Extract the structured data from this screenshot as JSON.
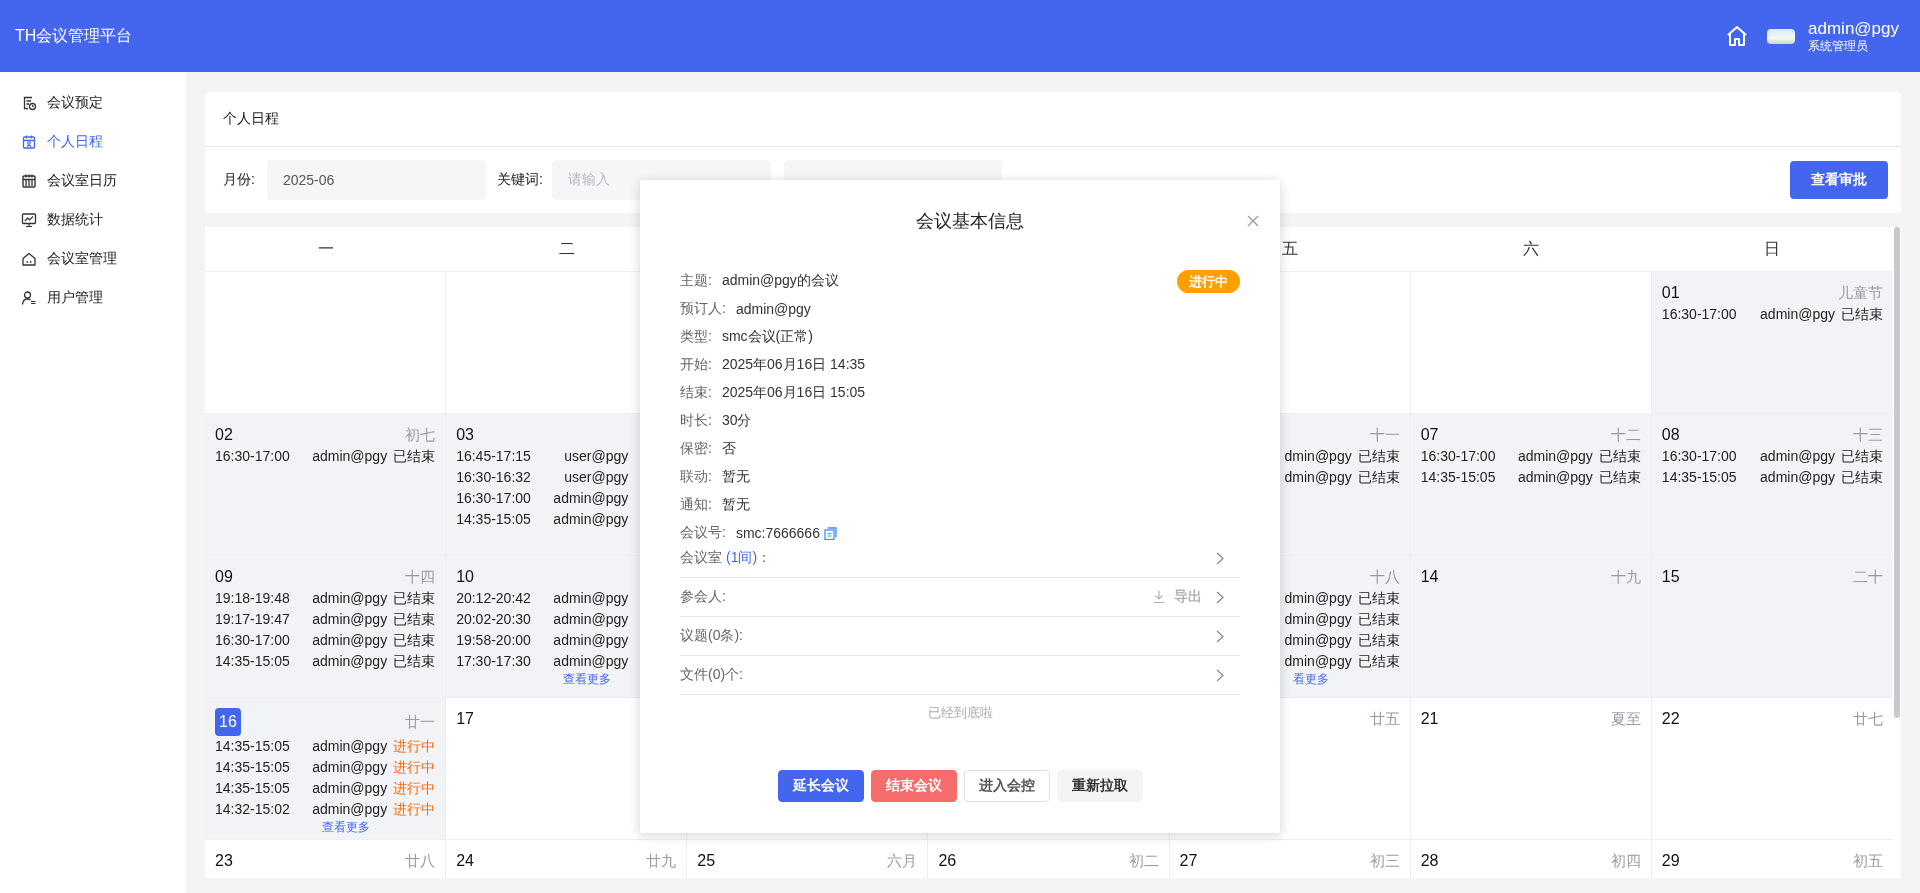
{
  "header": {
    "logo": "TH会议管理平台",
    "user": {
      "name": "admin@pgy",
      "role": "系统管理员"
    }
  },
  "sidebar": {
    "items": [
      {
        "label": "会议预定",
        "selected": false
      },
      {
        "label": "个人日程",
        "selected": true
      },
      {
        "label": "会议室日历",
        "selected": false
      },
      {
        "label": "数据统计",
        "selected": false
      },
      {
        "label": "会议室管理",
        "selected": false
      },
      {
        "label": "用户管理",
        "selected": false
      }
    ]
  },
  "page": {
    "title": "个人日程"
  },
  "filters": {
    "month": {
      "label": "月份:",
      "value": "2025-06"
    },
    "keyword": {
      "label": "关键词:",
      "placeholder": "请输入"
    },
    "approval_button": "查看审批"
  },
  "calendar": {
    "weekdays": {
      "mon": "一",
      "tue": "二",
      "fri": "五",
      "sat": "六",
      "sun": "日"
    },
    "weeks": [
      {
        "sun": {
          "date": "01",
          "lunar": "儿童节",
          "past": true,
          "today": false,
          "events": [
            {
              "time": "16:30-17:00",
              "user": "admin@pgy",
              "status": "已结束",
              "color": "#222222"
            }
          ]
        }
      },
      {
        "mon": {
          "date": "02",
          "lunar": "初七",
          "past": true,
          "today": false,
          "events": [
            {
              "time": "16:30-17:00",
              "user": "admin@pgy",
              "status": "已结束",
              "color": "#222222"
            }
          ]
        },
        "tue": {
          "date": "03",
          "past": true,
          "today": false,
          "events": [
            {
              "time": "16:45-17:15",
              "user": "user@pgy"
            },
            {
              "time": "16:30-16:32",
              "user": "user@pgy"
            },
            {
              "time": "16:30-17:00",
              "user": "admin@pgy"
            },
            {
              "time": "14:35-15:05",
              "user": "admin@pgy"
            }
          ]
        },
        "fri": {
          "lunar": "十一",
          "past": true,
          "events": [
            {
              "user": "dmin@pgy",
              "status": "已结束",
              "color": "#222222"
            },
            {
              "user": "dmin@pgy",
              "status": "已结束",
              "color": "#222222"
            }
          ]
        },
        "sat": {
          "date": "07",
          "lunar": "十二",
          "past": true,
          "today": false,
          "events": [
            {
              "time": "16:30-17:00",
              "user": "admin@pgy",
              "status": "已结束",
              "color": "#222222"
            },
            {
              "time": "14:35-15:05",
              "user": "admin@pgy",
              "status": "已结束",
              "color": "#222222"
            }
          ]
        },
        "sun": {
          "date": "08",
          "lunar": "十三",
          "past": true,
          "today": false,
          "events": [
            {
              "time": "16:30-17:00",
              "user": "admin@pgy",
              "status": "已结束",
              "color": "#222222"
            },
            {
              "time": "14:35-15:05",
              "user": "admin@pgy",
              "status": "已结束",
              "color": "#222222"
            }
          ]
        }
      },
      {
        "mon": {
          "date": "09",
          "lunar": "十四",
          "past": true,
          "today": false,
          "events": [
            {
              "time": "19:18-19:48",
              "user": "admin@pgy",
              "status": "已结束",
              "color": "#222222"
            },
            {
              "time": "19:17-19:47",
              "user": "admin@pgy",
              "status": "已结束",
              "color": "#222222"
            },
            {
              "time": "16:30-17:00",
              "user": "admin@pgy",
              "status": "已结束",
              "color": "#222222"
            },
            {
              "time": "14:35-15:05",
              "user": "admin@pgy",
              "status": "已结束",
              "color": "#222222"
            }
          ]
        },
        "tue": {
          "date": "10",
          "past": true,
          "today": false,
          "events": [
            {
              "time": "20:12-20:42",
              "user": "admin@pgy"
            },
            {
              "time": "20:02-20:30",
              "user": "admin@pgy"
            },
            {
              "time": "19:58-20:00",
              "user": "admin@pgy"
            },
            {
              "time": "17:30-17:30",
              "user": "admin@pgy"
            }
          ],
          "more": "查看更多"
        },
        "fri": {
          "lunar": "十八",
          "past": true,
          "events": [
            {
              "user": "dmin@pgy",
              "status": "已结束",
              "color": "#222222"
            },
            {
              "user": "dmin@pgy",
              "status": "已结束",
              "color": "#222222"
            },
            {
              "user": "dmin@pgy",
              "status": "已结束",
              "color": "#222222"
            },
            {
              "user": "dmin@pgy",
              "status": "已结束",
              "color": "#222222"
            }
          ],
          "more": "看更多"
        },
        "sat": {
          "date": "14",
          "lunar": "十九",
          "past": true,
          "today": false
        },
        "sun": {
          "date": "15",
          "lunar": "二十",
          "past": true,
          "today": false
        }
      },
      {
        "mon": {
          "date": "16",
          "lunar": "廿一",
          "past": true,
          "today": true,
          "events": [
            {
              "time": "14:35-15:05",
              "user": "admin@pgy",
              "status": "进行中",
              "color": "#ff6a00"
            },
            {
              "time": "14:35-15:05",
              "user": "admin@pgy",
              "status": "进行中",
              "color": "#ff6a00"
            },
            {
              "time": "14:35-15:05",
              "user": "admin@pgy",
              "status": "进行中",
              "color": "#ff6a00"
            },
            {
              "time": "14:32-15:02",
              "user": "admin@pgy",
              "status": "进行中",
              "color": "#ff6a00"
            }
          ],
          "more": "查看更多"
        },
        "tue": {
          "date": "17",
          "past": false,
          "today": false
        },
        "fri": {
          "lunar": "廿五",
          "past": false
        },
        "sat": {
          "date": "21",
          "lunar": "夏至",
          "past": false,
          "today": false
        },
        "sun": {
          "date": "22",
          "lunar": "廿七",
          "past": false,
          "today": false
        }
      },
      {
        "mon": {
          "date": "23",
          "lunar": "廿八",
          "past": false,
          "today": false
        },
        "tue": {
          "date": "24",
          "lunar": "廿九",
          "past": false,
          "today": false
        },
        "wed": {
          "date": "25",
          "lunar": "六月",
          "past": false,
          "today": false
        },
        "thu": {
          "date": "26",
          "lunar": "初二",
          "past": false,
          "today": false
        },
        "fri": {
          "date": "27",
          "lunar": "初三",
          "past": false,
          "today": false
        },
        "sat": {
          "date": "28",
          "lunar": "初四",
          "past": false,
          "today": false
        },
        "sun": {
          "date": "29",
          "lunar": "初五",
          "past": false,
          "today": false
        }
      }
    ]
  },
  "meeting_dialog": {
    "title": "会议基本信息",
    "status_badge": {
      "label": "进行中",
      "color": "#ff9f00"
    },
    "fields": [
      {
        "label": "主题:",
        "value": "admin@pgy的会议"
      },
      {
        "label": "预订人:",
        "value": "admin@pgy"
      },
      {
        "label": "类型:",
        "value": "smc会议(正常)"
      },
      {
        "label": "开始:",
        "value": "2025年06月16日 14:35"
      },
      {
        "label": "结束:",
        "value": "2025年06月16日 15:05"
      },
      {
        "label": "时长:",
        "value": "30分"
      },
      {
        "label": "保密:",
        "value": "否"
      },
      {
        "label": "联动:",
        "value": "暂无"
      },
      {
        "label": "通知:",
        "value": "暂无"
      },
      {
        "label": "会议号:",
        "value": "smc:7666666",
        "copyable": true
      }
    ],
    "sections": [
      {
        "label": "会议室",
        "count": "(1间)",
        "suffix": "："
      },
      {
        "label": "参会人:",
        "action": "导出"
      },
      {
        "label": "议题(0条):"
      },
      {
        "label": "文件(0)个:"
      }
    ],
    "end_note": "已经到底啦",
    "buttons": [
      {
        "label": "延长会议",
        "kind": "primary"
      },
      {
        "label": "结束会议",
        "kind": "danger"
      },
      {
        "label": "进入会控",
        "kind": "outline"
      },
      {
        "label": "重新拉取",
        "kind": "plain"
      }
    ]
  }
}
